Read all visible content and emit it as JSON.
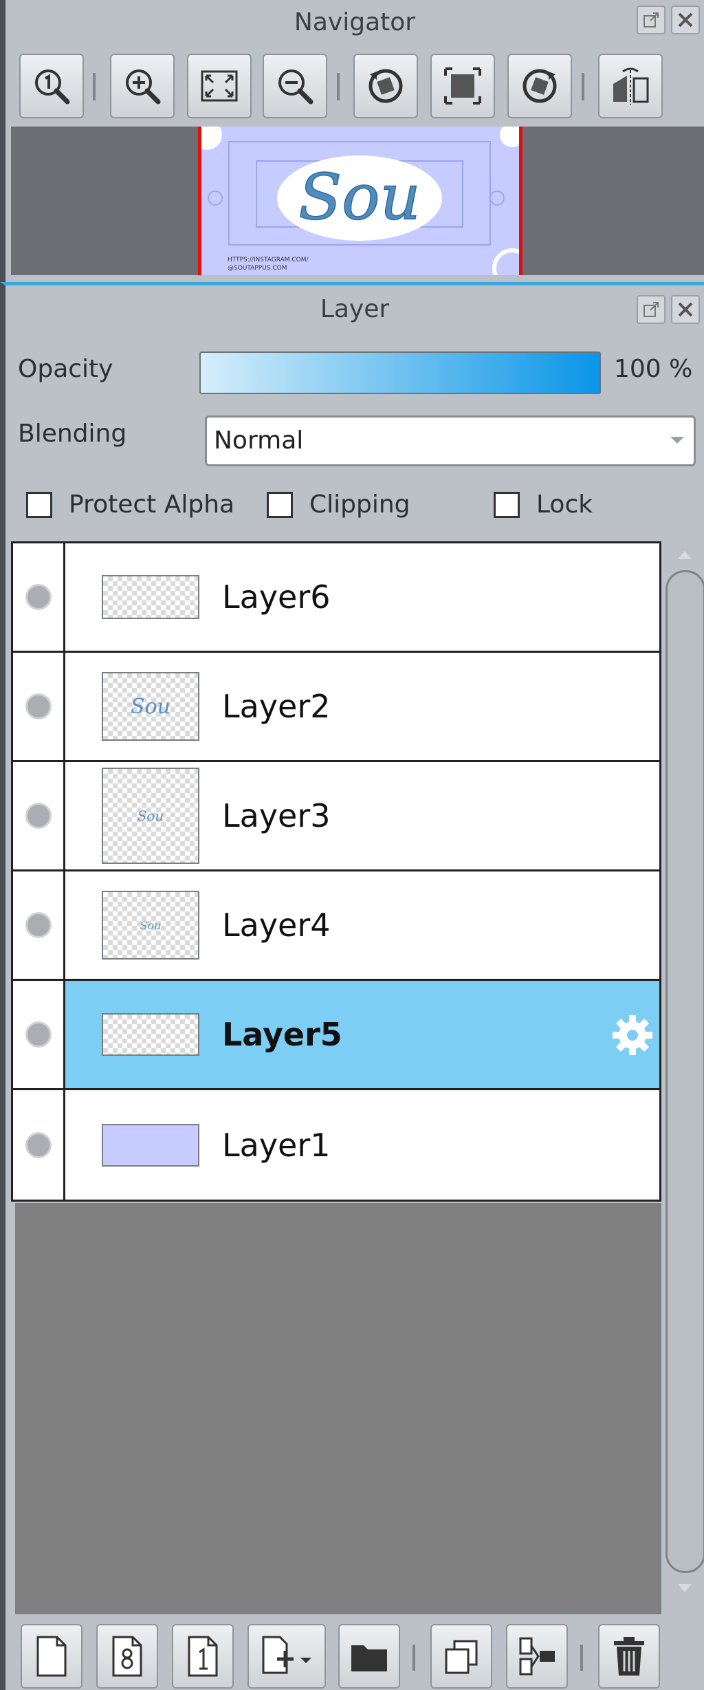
{
  "navigator": {
    "title": "Navigator",
    "thumbnail_text": "Sou",
    "thumbnail_caption_1": "HTTPS://INSTAGRAM.COM/",
    "thumbnail_caption_2": "@SOUTAPPUS.COM"
  },
  "layer_panel": {
    "title": "Layer",
    "opacity_label": "Opacity",
    "opacity_value": "100 %",
    "opacity_fraction": 1.0,
    "blending_label": "Blending",
    "blending_value": "Normal",
    "checkboxes": {
      "protect_alpha": "Protect Alpha",
      "clipping": "Clipping",
      "lock": "Lock"
    },
    "layers": [
      {
        "name": "Layer6",
        "selected": false,
        "thumb_text": ""
      },
      {
        "name": "Layer2",
        "selected": false,
        "thumb_text": "Sou"
      },
      {
        "name": "Layer3",
        "selected": false,
        "thumb_text": "Sou"
      },
      {
        "name": "Layer4",
        "selected": false,
        "thumb_text": "Sou"
      },
      {
        "name": "Layer5",
        "selected": true,
        "thumb_text": ""
      },
      {
        "name": "Layer1",
        "selected": false,
        "thumb_text": ""
      }
    ]
  },
  "colors": {
    "selected_row": "#7dcef5",
    "accent": "#38a8e0",
    "canvas_fill": "#c6ccff",
    "nav_frame": "#e01010"
  },
  "icons": {
    "navigator_toolbar": [
      "zoom-actual-size-icon",
      "zoom-in-icon",
      "fit-to-window-icon",
      "zoom-out-icon",
      "rotate-left-icon",
      "reset-view-icon",
      "rotate-right-icon",
      "flip-horizontal-icon"
    ],
    "layer_toolbar": [
      "new-layer-icon",
      "new-8bit-layer-icon",
      "new-1bit-layer-icon",
      "add-layer-menu-icon",
      "new-folder-icon",
      "duplicate-layer-icon",
      "merge-down-icon",
      "delete-layer-icon"
    ]
  }
}
